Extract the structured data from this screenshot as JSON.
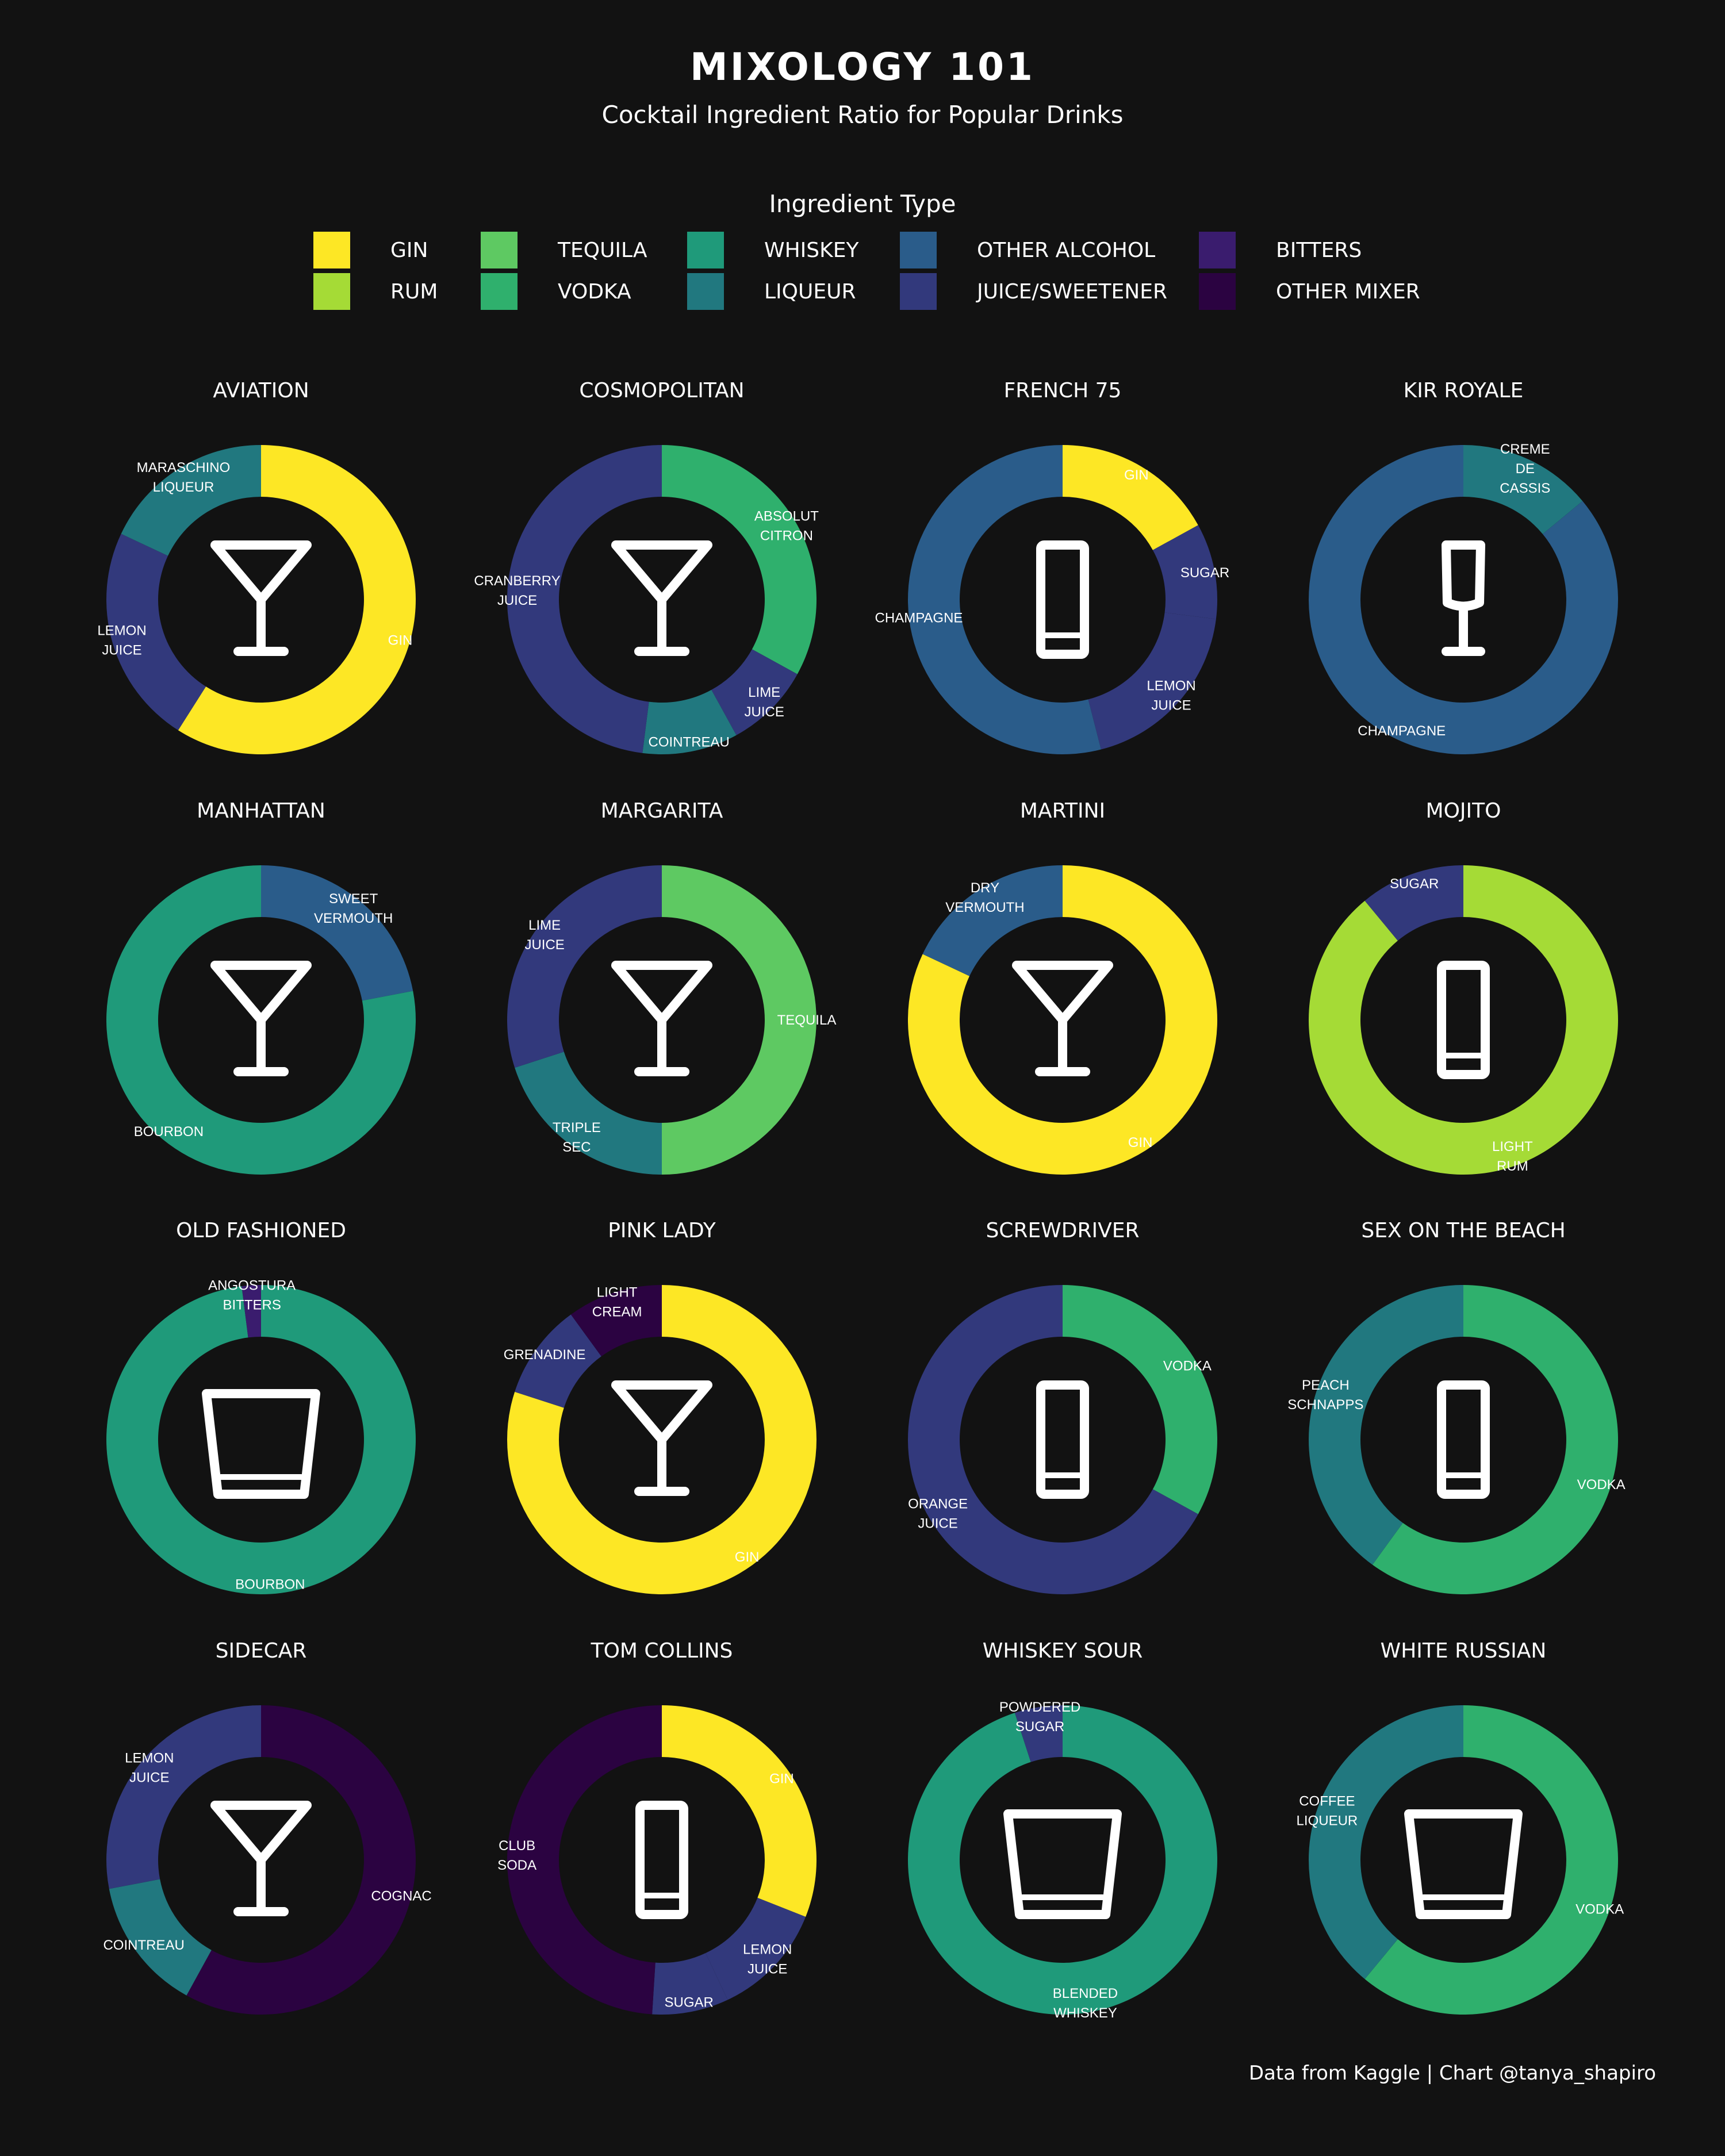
{
  "header": {
    "title": "MIXOLOGY 101",
    "subtitle": "Cocktail Ingredient Ratio for Popular Drinks"
  },
  "legend": {
    "title": "Ingredient Type",
    "items": [
      {
        "label": "GIN",
        "color": "#fde725"
      },
      {
        "label": "RUM",
        "color": "#a5db36"
      },
      {
        "label": "TEQUILA",
        "color": "#5ec962"
      },
      {
        "label": "VODKA",
        "color": "#2fb06d"
      },
      {
        "label": "WHISKEY",
        "color": "#1f9a7a"
      },
      {
        "label": "LIQUEUR",
        "color": "#21787f"
      },
      {
        "label": "OTHER ALCOHOL",
        "color": "#2a5c8a"
      },
      {
        "label": "JUICE/SWEETENER",
        "color": "#32397c"
      },
      {
        "label": "BITTERS",
        "color": "#3a1c6e"
      },
      {
        "label": "OTHER MIXER",
        "color": "#2b0341"
      }
    ]
  },
  "chart_data": [
    {
      "type": "pie",
      "title": "AVIATION",
      "glass": "cocktail",
      "slices": [
        {
          "label": "GIN",
          "category": "GIN",
          "value": 0.59
        },
        {
          "label": "LEMON JUICE",
          "category": "JUICE/SWEETENER",
          "value": 0.23
        },
        {
          "label": "MARASCHINO LIQUEUR",
          "category": "LIQUEUR",
          "value": 0.18
        }
      ]
    },
    {
      "type": "pie",
      "title": "COSMOPOLITAN",
      "glass": "cocktail",
      "slices": [
        {
          "label": "ABSOLUT CITRON",
          "category": "VODKA",
          "value": 0.33
        },
        {
          "label": "LIME JUICE",
          "category": "JUICE/SWEETENER",
          "value": 0.09
        },
        {
          "label": "COINTREAU",
          "category": "LIQUEUR",
          "value": 0.1
        },
        {
          "label": "CRANBERRY JUICE",
          "category": "JUICE/SWEETENER",
          "value": 0.48
        }
      ]
    },
    {
      "type": "pie",
      "title": "FRENCH 75",
      "glass": "highball",
      "slices": [
        {
          "label": "GIN",
          "category": "GIN",
          "value": 0.17
        },
        {
          "label": "SUGAR",
          "category": "JUICE/SWEETENER",
          "value": 0.1
        },
        {
          "label": "LEMON JUICE",
          "category": "JUICE/SWEETENER",
          "value": 0.19
        },
        {
          "label": "CHAMPAGNE",
          "category": "OTHER ALCOHOL",
          "value": 0.54
        }
      ]
    },
    {
      "type": "pie",
      "title": "KIR ROYALE",
      "glass": "flute",
      "slices": [
        {
          "label": "CREME DE CASSIS",
          "category": "LIQUEUR",
          "value": 0.14
        },
        {
          "label": "CHAMPAGNE",
          "category": "OTHER ALCOHOL",
          "value": 0.86
        }
      ]
    },
    {
      "type": "pie",
      "title": "MANHATTAN",
      "glass": "cocktail",
      "slices": [
        {
          "label": "SWEET VERMOUTH",
          "category": "OTHER ALCOHOL",
          "value": 0.22
        },
        {
          "label": "BOURBON",
          "category": "WHISKEY",
          "value": 0.78
        }
      ]
    },
    {
      "type": "pie",
      "title": "MARGARITA",
      "glass": "cocktail",
      "slices": [
        {
          "label": "TEQUILA",
          "category": "TEQUILA",
          "value": 0.5
        },
        {
          "label": "TRIPLE SEC",
          "category": "LIQUEUR",
          "value": 0.2
        },
        {
          "label": "LIME JUICE",
          "category": "JUICE/SWEETENER",
          "value": 0.3
        }
      ]
    },
    {
      "type": "pie",
      "title": "MARTINI",
      "glass": "cocktail",
      "slices": [
        {
          "label": "GIN",
          "category": "GIN",
          "value": 0.82
        },
        {
          "label": "DRY VERMOUTH",
          "category": "OTHER ALCOHOL",
          "value": 0.18
        }
      ]
    },
    {
      "type": "pie",
      "title": "MOJITO",
      "glass": "highball",
      "slices": [
        {
          "label": "LIGHT RUM",
          "category": "RUM",
          "value": 0.89
        },
        {
          "label": "SUGAR",
          "category": "JUICE/SWEETENER",
          "value": 0.11
        }
      ]
    },
    {
      "type": "pie",
      "title": "OLD FASHIONED",
      "glass": "rocks",
      "slices": [
        {
          "label": "BOURBON",
          "category": "WHISKEY",
          "value": 0.98
        },
        {
          "label": "ANGOSTURA BITTERS",
          "category": "BITTERS",
          "value": 0.02
        }
      ]
    },
    {
      "type": "pie",
      "title": "PINK LADY",
      "glass": "cocktail",
      "slices": [
        {
          "label": "GIN",
          "category": "GIN",
          "value": 0.8
        },
        {
          "label": "GRENADINE",
          "category": "JUICE/SWEETENER",
          "value": 0.1
        },
        {
          "label": "LIGHT CREAM",
          "category": "OTHER MIXER",
          "value": 0.1
        }
      ]
    },
    {
      "type": "pie",
      "title": "SCREWDRIVER",
      "glass": "highball",
      "slices": [
        {
          "label": "VODKA",
          "category": "VODKA",
          "value": 0.33
        },
        {
          "label": "ORANGE JUICE",
          "category": "JUICE/SWEETENER",
          "value": 0.67
        }
      ]
    },
    {
      "type": "pie",
      "title": "SEX ON THE BEACH",
      "glass": "highball",
      "slices": [
        {
          "label": "VODKA",
          "category": "VODKA",
          "value": 0.6
        },
        {
          "label": "PEACH SCHNAPPS",
          "category": "LIQUEUR",
          "value": 0.4
        }
      ]
    },
    {
      "type": "pie",
      "title": "SIDECAR",
      "glass": "cocktail",
      "slices": [
        {
          "label": "COGNAC",
          "category": "OTHER MIXER",
          "value": 0.58
        },
        {
          "label": "COINTREAU",
          "category": "LIQUEUR",
          "value": 0.14
        },
        {
          "label": "LEMON JUICE",
          "category": "JUICE/SWEETENER",
          "value": 0.28
        }
      ]
    },
    {
      "type": "pie",
      "title": "TOM COLLINS",
      "glass": "highball",
      "slices": [
        {
          "label": "GIN",
          "category": "GIN",
          "value": 0.31
        },
        {
          "label": "LEMON JUICE",
          "category": "JUICE/SWEETENER",
          "value": 0.12
        },
        {
          "label": "SUGAR",
          "category": "JUICE/SWEETENER",
          "value": 0.08
        },
        {
          "label": "CLUB SODA",
          "category": "OTHER MIXER",
          "value": 0.49
        }
      ]
    },
    {
      "type": "pie",
      "title": "WHISKEY SOUR",
      "glass": "rocks",
      "slices": [
        {
          "label": "BLENDED WHISKEY",
          "category": "WHISKEY",
          "value": 0.95
        },
        {
          "label": "POWDERED SUGAR",
          "category": "JUICE/SWEETENER",
          "value": 0.05
        }
      ]
    },
    {
      "type": "pie",
      "title": "WHITE RUSSIAN",
      "glass": "rocks",
      "slices": [
        {
          "label": "VODKA",
          "category": "VODKA",
          "value": 0.61
        },
        {
          "label": "COFFEE LIQUEUR",
          "category": "LIQUEUR",
          "value": 0.39
        }
      ]
    }
  ],
  "footer": "Data from Kaggle | Chart @tanya_shapiro"
}
